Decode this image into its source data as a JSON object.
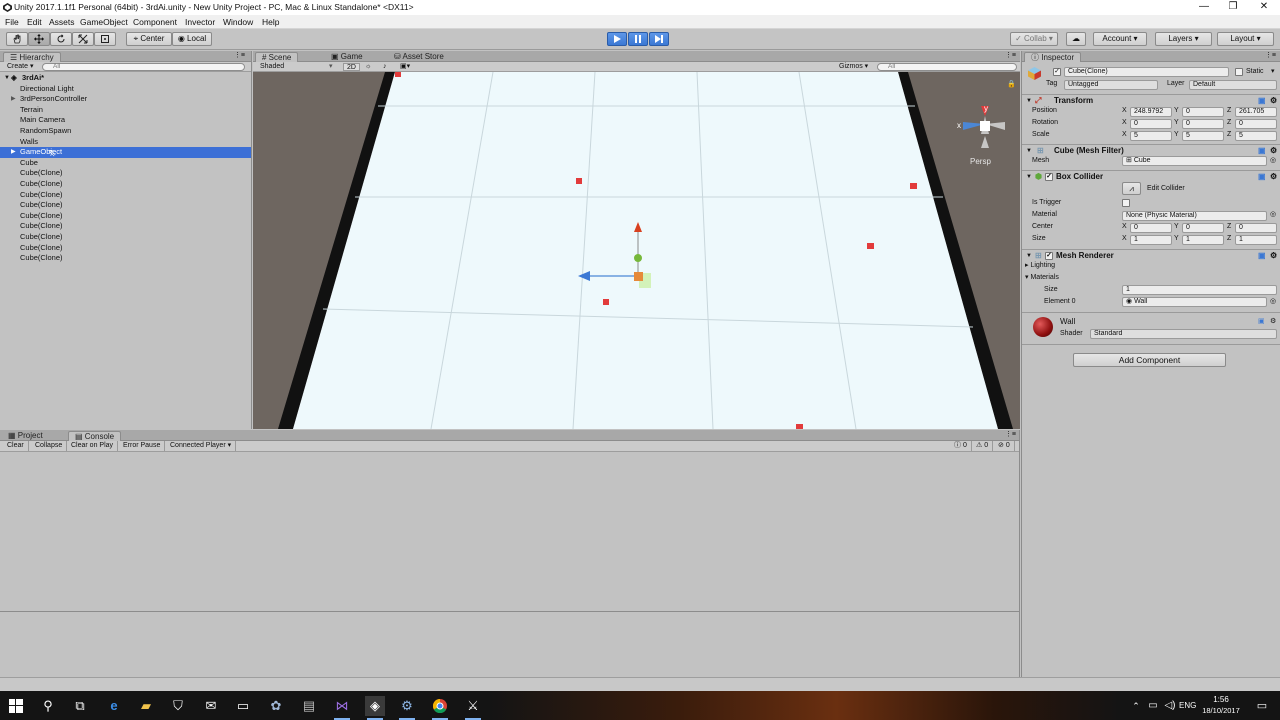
{
  "window": {
    "title": "Unity 2017.1.1f1 Personal (64bit) - 3rdAi.unity - New Unity Project - PC, Mac & Linux Standalone* <DX11>",
    "controls": [
      "—",
      "❐",
      "✕"
    ]
  },
  "menu": [
    "File",
    "Edit",
    "Assets",
    "GameObject",
    "Component",
    "Invector",
    "Window",
    "Help"
  ],
  "toolbar": {
    "pivot": "Center",
    "space": "Local",
    "collab": "Collab ▾",
    "account": "Account",
    "layers": "Layers",
    "layout": "Layout"
  },
  "hierarchy": {
    "tab": "Hierarchy",
    "create": "Create ▾",
    "search_placeholder": "All",
    "scene": "3rdAi*",
    "items": [
      {
        "label": "Directional Light",
        "expandable": false
      },
      {
        "label": "3rdPersonController",
        "expandable": true
      },
      {
        "label": "Terrain",
        "expandable": false
      },
      {
        "label": "Main Camera",
        "expandable": false
      },
      {
        "label": "RandomSpawn",
        "expandable": false
      },
      {
        "label": "Walls",
        "expandable": false
      },
      {
        "label": "GameObject",
        "expandable": true,
        "selected": true
      },
      {
        "label": "Cube",
        "expandable": false
      },
      {
        "label": "Cube(Clone)",
        "expandable": false
      },
      {
        "label": "Cube(Clone)",
        "expandable": false
      },
      {
        "label": "Cube(Clone)",
        "expandable": false
      },
      {
        "label": "Cube(Clone)",
        "expandable": false
      },
      {
        "label": "Cube(Clone)",
        "expandable": false
      },
      {
        "label": "Cube(Clone)",
        "expandable": false
      },
      {
        "label": "Cube(Clone)",
        "expandable": false
      },
      {
        "label": "Cube(Clone)",
        "expandable": false
      },
      {
        "label": "Cube(Clone)",
        "expandable": false
      }
    ]
  },
  "scene_view": {
    "tabs": [
      "Scene",
      "Game",
      "Asset Store"
    ],
    "active_tab": "Scene",
    "shading": "Shaded",
    "mode_2d": "2D",
    "gizmos": "Gizmos ▾",
    "search_placeholder": "All",
    "projection": "Persp"
  },
  "inspector": {
    "tab": "Inspector",
    "object_name": "Cube(Clone)",
    "static_label": "Static",
    "tag_label": "Tag",
    "tag_value": "Untagged",
    "layer_label": "Layer",
    "layer_value": "Default",
    "transform": {
      "title": "Transform",
      "position_label": "Position",
      "rotation_label": "Rotation",
      "scale_label": "Scale",
      "position": [
        "248.9792",
        "0",
        "261.705"
      ],
      "rotation": [
        "0",
        "0",
        "0"
      ],
      "scale": [
        "5",
        "5",
        "5"
      ]
    },
    "mesh_filter": {
      "title": "Cube (Mesh Filter)",
      "mesh_label": "Mesh",
      "mesh_value": "Cube"
    },
    "box_collider": {
      "title": "Box Collider",
      "edit_label": "Edit Collider",
      "is_trigger_label": "Is Trigger",
      "material_label": "Material",
      "material_value": "None (Physic Material)",
      "center_label": "Center",
      "center": [
        "0",
        "0",
        "0"
      ],
      "size_label": "Size",
      "size": [
        "1",
        "1",
        "1"
      ]
    },
    "mesh_renderer": {
      "title": "Mesh Renderer",
      "lighting_label": "Lighting",
      "materials_label": "Materials",
      "size_label": "Size",
      "size_value": "1",
      "element_label": "Element 0",
      "element_value": "Wall"
    },
    "material": {
      "name": "Wall",
      "shader_label": "Shader",
      "shader_value": "Standard"
    },
    "add_component": "Add Component"
  },
  "console": {
    "tabs": [
      "Project",
      "Console"
    ],
    "active_tab": "Console",
    "buttons": [
      "Clear",
      "Collapse",
      "Clear on Play",
      "Error Pause",
      "Connected Player ▾"
    ],
    "counts": [
      "0",
      "0",
      "0"
    ]
  },
  "taskbar": {
    "language": "ENG",
    "time": "1:56",
    "date": "18/10/2017"
  },
  "colors": {
    "selection": "#3c6fd6",
    "play_active": "#3b78d4",
    "floor": "#eef9fc",
    "cube_red": "#e23b3b"
  }
}
